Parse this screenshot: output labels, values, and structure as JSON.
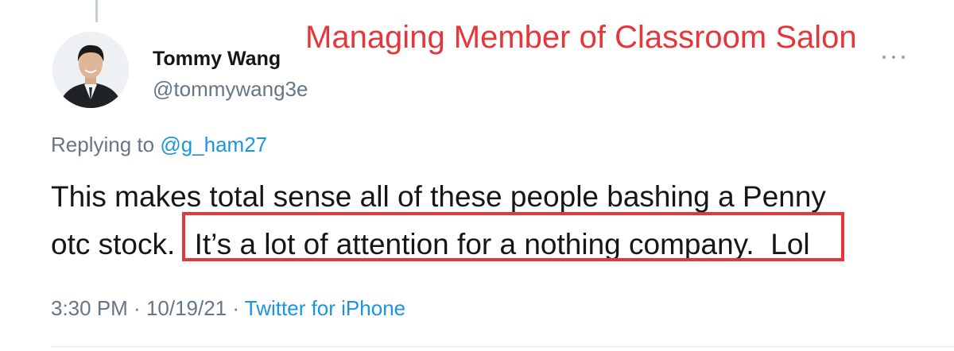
{
  "annotation": {
    "text": "Managing Member of Classroom Salon",
    "color": "#e5373b"
  },
  "tweet": {
    "author": {
      "display_name": "Tommy Wang",
      "handle": "@tommywang3e",
      "avatar_icon": "profile-photo"
    },
    "reply": {
      "prefix": "Replying to",
      "mention": "@g_ham27"
    },
    "text": {
      "line1": "This makes total sense all of these people bashing a Penny",
      "line2_start": "otc stock.",
      "line2_highlight": "It’s a lot of attention for a nothing company.  Lol"
    },
    "meta": {
      "time": "3:30 PM",
      "sep1": " · ",
      "date": "10/19/21",
      "sep2": " · ",
      "source": "Twitter for iPhone"
    },
    "more_icon": "more-dots-icon"
  },
  "colors": {
    "text": "#14171a",
    "secondary": "#657786",
    "link": "#1b95e0",
    "annotation_red": "#e5373b"
  }
}
